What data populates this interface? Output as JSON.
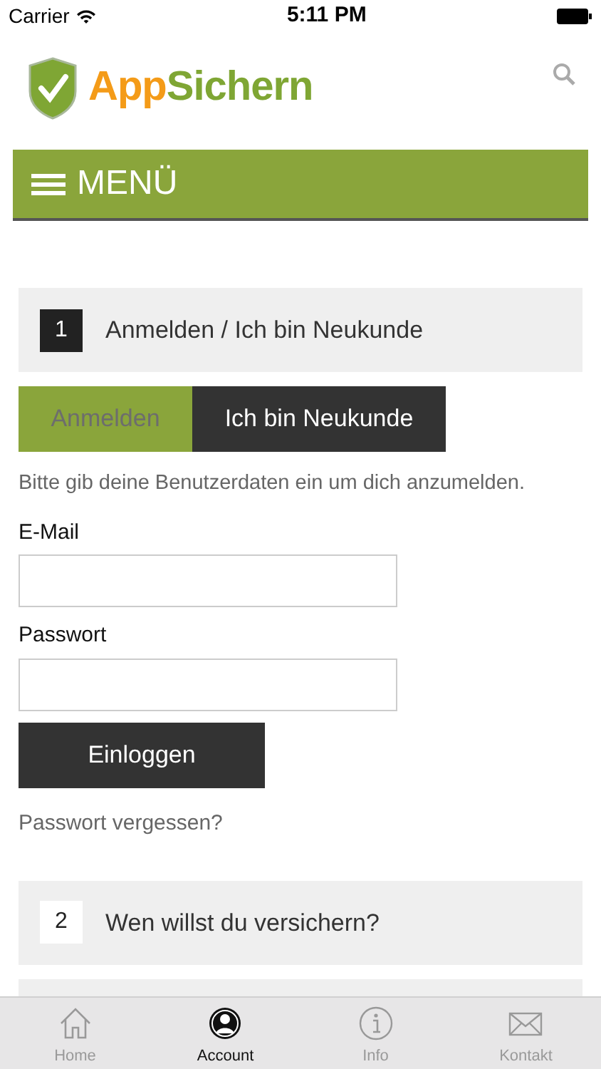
{
  "status_bar": {
    "carrier": "Carrier",
    "time": "5:11 PM"
  },
  "header": {
    "logo_part_1": "App",
    "logo_part_2": "Sichern"
  },
  "menu": {
    "label": "MENÜ"
  },
  "steps_top": [
    {
      "number": "1",
      "title": "Anmelden / Ich bin Neukunde"
    }
  ],
  "login_tabs": [
    {
      "label": "Anmelden",
      "selected": true
    },
    {
      "label": "Ich bin Neukunde",
      "selected": false
    }
  ],
  "hint": "Bitte gib deine Benutzerdaten ein um dich anzumelden.",
  "fields": [
    {
      "label": "E-Mail"
    },
    {
      "label": "Passwort"
    }
  ],
  "submit": "Einloggen",
  "forgot_link": "Passwort vergessen?",
  "steps_bottom": [
    {
      "number": "2",
      "title": "Wen willst du versichern?"
    }
  ],
  "tab_bar": [
    {
      "label": "Home",
      "kind": "home",
      "selected": false
    },
    {
      "label": "Account",
      "kind": "account",
      "selected": true
    },
    {
      "label": "Info",
      "kind": "info",
      "selected": false
    },
    {
      "label": "Kontakt",
      "kind": "mail",
      "selected": false
    }
  ]
}
